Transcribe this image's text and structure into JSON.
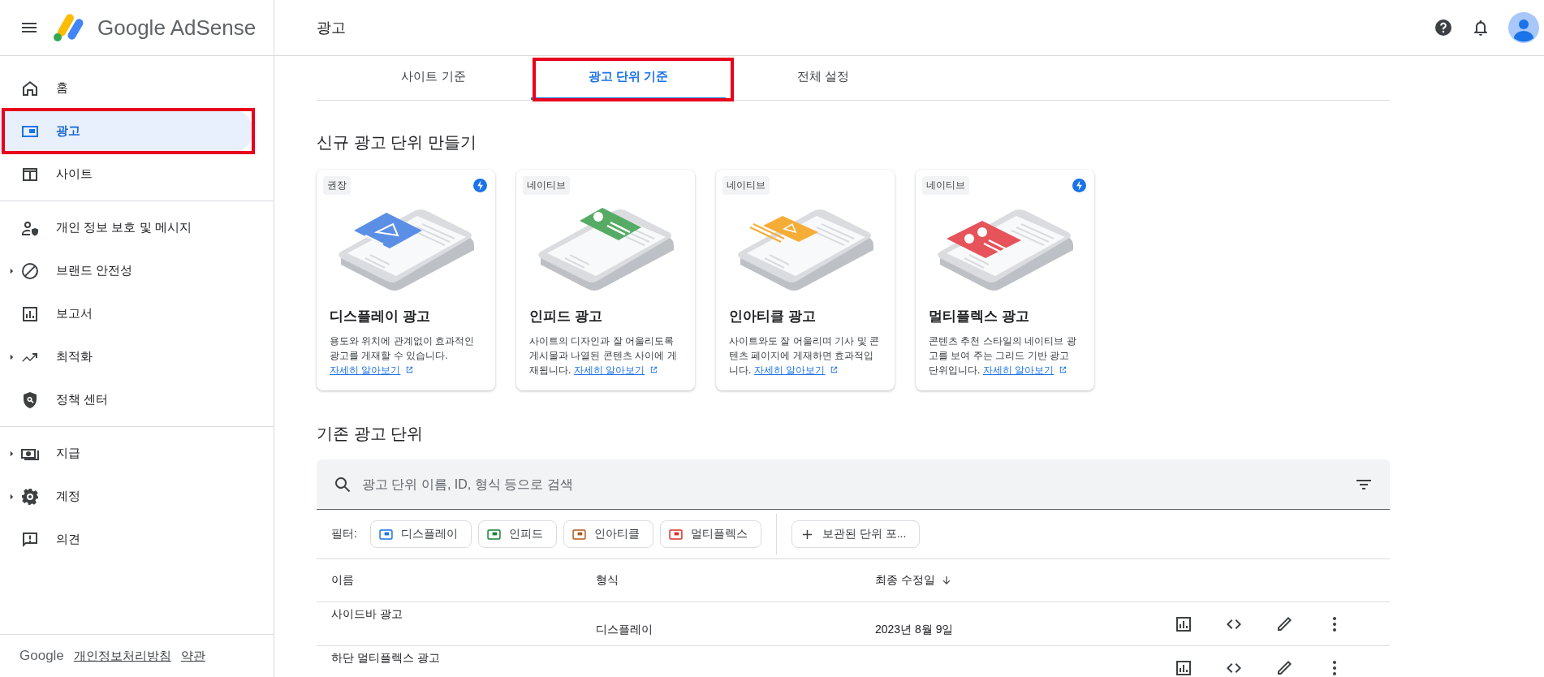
{
  "header": {
    "brand": "Google AdSense",
    "page_title": "광고"
  },
  "sidebar": {
    "groups": [
      [
        {
          "label": "홈",
          "selected": false,
          "expandable": false,
          "annotated": false
        },
        {
          "label": "광고",
          "selected": true,
          "expandable": false,
          "annotated": true
        },
        {
          "label": "사이트",
          "selected": false,
          "expandable": false,
          "annotated": false
        }
      ],
      [
        {
          "label": "개인 정보 보호 및 메시지",
          "selected": false,
          "expandable": false,
          "annotated": false
        },
        {
          "label": "브랜드 안전성",
          "selected": false,
          "expandable": true,
          "annotated": false
        },
        {
          "label": "보고서",
          "selected": false,
          "expandable": false,
          "annotated": false
        },
        {
          "label": "최적화",
          "selected": false,
          "expandable": true,
          "annotated": false
        },
        {
          "label": "정책 센터",
          "selected": false,
          "expandable": false,
          "annotated": false
        }
      ],
      [
        {
          "label": "지급",
          "selected": false,
          "expandable": true,
          "annotated": false
        },
        {
          "label": "계정",
          "selected": false,
          "expandable": true,
          "annotated": false
        },
        {
          "label": "의견",
          "selected": false,
          "expandable": false,
          "annotated": false
        }
      ]
    ],
    "footer": {
      "brand": "Google",
      "links": [
        "개인정보처리방침",
        "약관"
      ]
    }
  },
  "tabs": [
    {
      "label": "사이트 기준",
      "selected": false,
      "annotated": false
    },
    {
      "label": "광고 단위 기준",
      "selected": true,
      "annotated": true
    },
    {
      "label": "전체 설정",
      "selected": false,
      "annotated": false
    }
  ],
  "create_section": {
    "title": "신규 광고 단위 만들기",
    "cards": [
      {
        "tag": "권장",
        "bolt": true,
        "kind": "display",
        "color": "#5b8fe6",
        "title": "디스플레이 광고",
        "description": "용도와 위치에 관계없이 효과적인 광고를 게재할 수 있습니다.",
        "link": "자세히 알아보기"
      },
      {
        "tag": "네이티브",
        "bolt": false,
        "kind": "infeed",
        "color": "#55ab63",
        "title": "인피드 광고",
        "description": "사이트의 디자인과 잘 어울리도록 게시물과 나열된 콘텐츠 사이에 게재됩니다.",
        "link": "자세히 알아보기"
      },
      {
        "tag": "네이티브",
        "bolt": false,
        "kind": "inarticle",
        "color": "#f6ad37",
        "title": "인아티클 광고",
        "description": "사이트와도 잘 어울리며 기사 및 콘텐츠 페이지에 게재하면 효과적입니다.",
        "link": "자세히 알아보기"
      },
      {
        "tag": "네이티브",
        "bolt": true,
        "kind": "multiplex",
        "color": "#e6535a",
        "title": "멀티플렉스 광고",
        "description": "콘텐츠 추천 스타일의 네이티브 광고를 보여 주는 그리드 기반 광고 단위입니다.",
        "link": "자세히 알아보기"
      }
    ]
  },
  "existing_section": {
    "title": "기존 광고 단위",
    "search": {
      "placeholder": "광고 단위 이름, ID, 형식 등으로 검색"
    },
    "filter_label": "필터:",
    "filters": [
      {
        "label": "디스플레이",
        "color": "#1a73e8"
      },
      {
        "label": "인피드",
        "color": "#188038"
      },
      {
        "label": "인아티클",
        "color": "#b3581b"
      },
      {
        "label": "멀티플렉스",
        "color": "#d93025"
      }
    ],
    "archived_button": "보관된 단위 포...",
    "table": {
      "columns": [
        "이름",
        "형식",
        "최종 수정일"
      ],
      "rows": [
        {
          "name": "사이드바 광고",
          "format": "디스플레이",
          "modified": "2023년 8월 9일"
        },
        {
          "name": "하단 멀티플렉스 광고"
        }
      ]
    }
  }
}
